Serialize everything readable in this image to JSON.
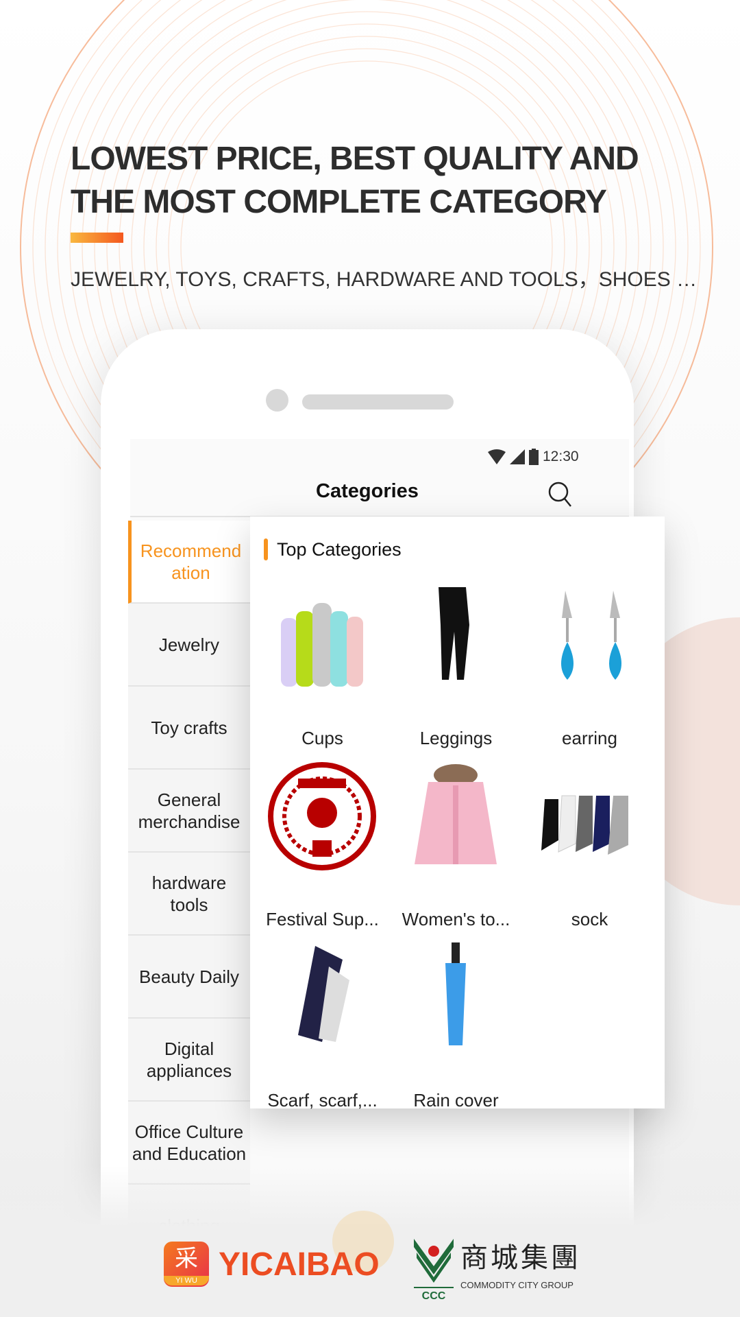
{
  "hero": {
    "headline_line1": "LOWEST PRICE, BEST QUALITY AND",
    "headline_line2": "THE MOST COMPLETE CATEGORY",
    "subtitle": "JEWELRY, TOYS, CRAFTS, HARDWARE AND TOOLS，SHOES …",
    "accent_colors": [
      "#f9b840",
      "#f4581f"
    ]
  },
  "status_bar": {
    "time": "12:30",
    "icons": [
      "wifi-icon",
      "signal-icon",
      "battery-icon"
    ]
  },
  "header": {
    "title": "Categories",
    "search_icon": "search-icon"
  },
  "sidebar": {
    "items": [
      {
        "label": "Recommendation",
        "active": true
      },
      {
        "label": "Jewelry"
      },
      {
        "label": "Toy crafts"
      },
      {
        "label": "General merchandise"
      },
      {
        "label": "hardware tools"
      },
      {
        "label": "Beauty Daily"
      },
      {
        "label": "Digital appliances"
      },
      {
        "label": "Office Culture and Education"
      },
      {
        "label": "clothing"
      }
    ]
  },
  "top_categories": {
    "heading": "Top Categories",
    "items": [
      {
        "label": "Cups"
      },
      {
        "label": "Leggings"
      },
      {
        "label": "earring"
      },
      {
        "label": "Festival Sup..."
      },
      {
        "label": "Women's to..."
      },
      {
        "label": "sock"
      },
      {
        "label": "Scarf, scarf,..."
      },
      {
        "label": "Rain cover"
      }
    ]
  },
  "accent_color": "#f7931e",
  "footer": {
    "logo1_text": "YICAIBAO",
    "logo1_icon_char": "采",
    "logo1_icon_sub": "YI WU",
    "logo2_cn": "商城集團",
    "logo2_en": "COMMODITY CITY GROUP",
    "logo2_mark": "CCC"
  }
}
